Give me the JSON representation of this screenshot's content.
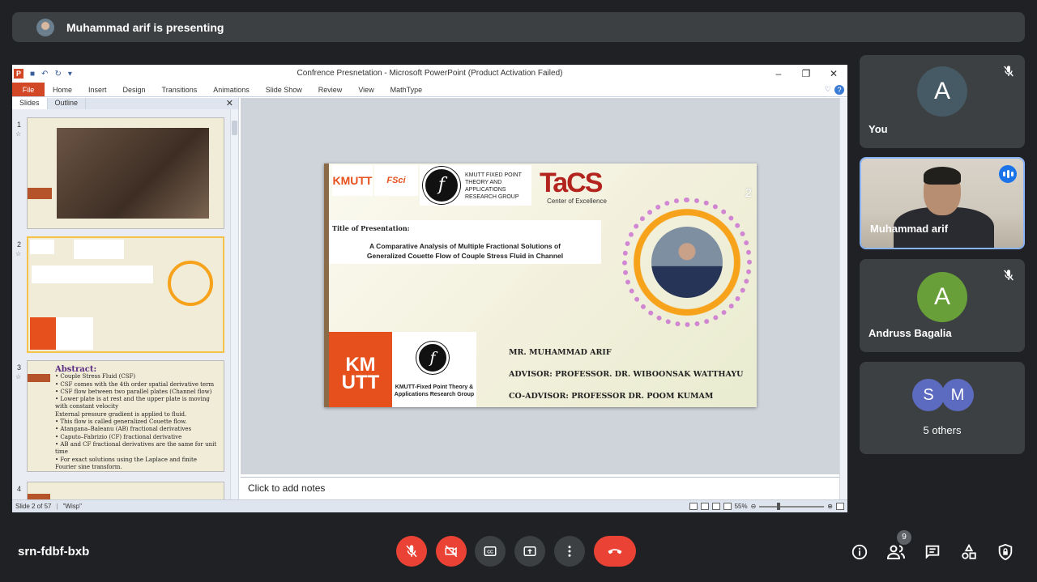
{
  "banner": {
    "text": "Muhammad arif is presenting"
  },
  "ppt": {
    "window_title": "Confrence Presnetation - Microsoft PowerPoint (Product Activation Failed)",
    "file_tab": "File",
    "tabs": [
      "Home",
      "Insert",
      "Design",
      "Transitions",
      "Animations",
      "Slide Show",
      "Review",
      "View",
      "MathType"
    ],
    "pane_tabs": [
      "Slides",
      "Outline"
    ],
    "thumb_numbers": [
      "1",
      "2",
      "3",
      "4"
    ],
    "notes_placeholder": "Click to add notes",
    "status_slide": "Slide 2 of 57",
    "status_theme": "\"Wisp\"",
    "zoom": "55%"
  },
  "slide": {
    "number": "2",
    "logo_kmutt": "KMUTT",
    "logo_fsci": "FSci",
    "kfp_text": "KMUTT FIXED POINT THEORY AND APPLICATIONS RESEARCH GROUP",
    "tacs_text": "TaCS",
    "tacs_sub": "Center of Excellence",
    "title_heading": "Title of Presentation:",
    "title_line1": "A Comparative Analysis of Multiple Fractional Solutions of",
    "title_line2": "Generalized Couette Flow of Couple Stress Fluid in Channel",
    "kmutt_big": "KM UTT",
    "kfprg_text": "KMUTT-Fixed Point Theory & Applications Research Group",
    "names": [
      "MR. MUHAMMAD ARIF",
      "ADVISOR: PROFESSOR. DR. WIBOONSAK WATTHAYU",
      "CO-ADVISOR: PROFESSOR DR. POOM KUMAM"
    ]
  },
  "thumb3": {
    "heading": "Abstract:",
    "lines": [
      "• Couple Stress Fluid (CSF)",
      "• CSF comes with the 4th order spatial derivative term",
      "• CSF flow between two parallel plates (Channel flow)",
      "• Lower plate is at rest and the upper plate is moving",
      "  with constant velocity",
      "External pressure gradient is applied to fluid.",
      "• This flow is called generalized Couette flow.",
      "• Atangana–Baleanu (AB) fractional derivatives",
      "• Caputo–Fabrizio (CF) fractional derivative",
      "• AB and CF fractional derivatives are the same for unit time",
      "• For exact solutions using the Laplace and finite",
      "  Fourier sine transform."
    ]
  },
  "participants": {
    "you": {
      "initial": "A",
      "name": "You",
      "color": "#455a64"
    },
    "arif": {
      "name": "Muhammad arif"
    },
    "andruss": {
      "initial": "A",
      "name": "Andruss Bagalia",
      "color": "#689f38"
    },
    "others": {
      "initials": [
        "S",
        "M"
      ],
      "label": "5 others",
      "colors": [
        "#5c6bc0",
        "#5c6bc0"
      ]
    }
  },
  "meeting": {
    "code": "srn-fdbf-bxb",
    "people_count": "9"
  }
}
